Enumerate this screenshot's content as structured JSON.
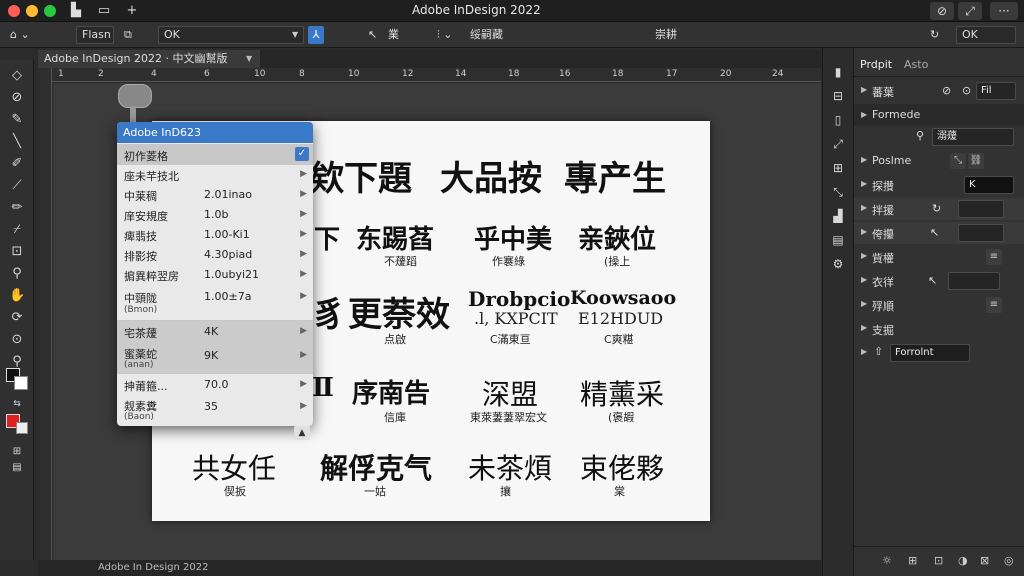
{
  "window": {
    "title": "Adobe InDesign 2022"
  },
  "controlbar": {
    "preset": "Flasn",
    "font_field": "OK",
    "tool_a": "業",
    "tool_b": "绥嗣藏",
    "tool_c": "崇耕",
    "right_button": "OK"
  },
  "document_tab": {
    "label": "Adobe InDesign 2022 · 中文幽幫版"
  },
  "ruler": {
    "ticks": [
      "1",
      "2",
      "4",
      "6",
      "10",
      "8",
      "10",
      "12",
      "14",
      "18",
      "16",
      "18",
      "17",
      "20",
      "24"
    ]
  },
  "page": {
    "rows": [
      {
        "big": [
          "欸下題",
          "大品按",
          "專产生"
        ]
      },
      {
        "big": [
          "东踢萏",
          "乎中美",
          "亲鋏位"
        ],
        "small": [
          "不蕿蹈",
          "作褰綠",
          "(操上"
        ]
      },
      {
        "big": [
          "更萘效",
          "Drobpcio",
          "Koowsaoo"
        ],
        "sub": [
          "",
          ".l, KXPCIT",
          "E12HDUD"
        ],
        "small": [
          "点啟",
          "C滿東亘",
          "C爽糂"
        ]
      },
      {
        "big": [
          "序南告",
          "深盟",
          "精薰采"
        ],
        "small": [
          "信庫",
          "東萊萋萋翠宏文",
          "(褒嘏"
        ]
      },
      {
        "big": [
          "共女任",
          "解俘克气",
          "未茶煩",
          "束佬夥"
        ],
        "small": [
          "偰扳",
          "一姑",
          "攘",
          "棠"
        ]
      }
    ],
    "left_partials": [
      "下",
      "豸",
      "Ⅱ"
    ]
  },
  "menu": {
    "header": "Adobe InD623",
    "rows": [
      {
        "label": "初作菱格",
        "value": "",
        "check": true
      },
      {
        "label": "座未芉技北",
        "value": ""
      },
      {
        "label": "中莱稠",
        "value": "2.01inao"
      },
      {
        "label": "庠安規度",
        "value": "1.0b"
      },
      {
        "label": "痺翡技",
        "value": "1.00-Ki1"
      },
      {
        "label": "排影按",
        "value": "4.30piad"
      },
      {
        "label": "掮異粹翌房",
        "value": "1.0ubyi21"
      },
      {
        "label": "中頸陇",
        "sub": "(Bmon)",
        "value": "1.00±7a"
      },
      {
        "label": "宅茶蕿",
        "value": "4K"
      },
      {
        "label": "蜜薬蛇",
        "sub": "(anan)",
        "value": "9K"
      },
      {
        "label": "抻莆箍...",
        "value": "70.0"
      },
      {
        "label": "觌素糞",
        "sub": "(Baon)",
        "value": "35"
      }
    ]
  },
  "panel": {
    "tabs": [
      "Prdpit",
      "Asto"
    ],
    "rows": [
      {
        "label": "蕃葉",
        "icons": [
          "⊘",
          "⊙"
        ],
        "field": "Fil"
      },
      {
        "label": "Formede"
      },
      {
        "label": "",
        "field": "溺蕿"
      },
      {
        "label": "Poslme",
        "field": ""
      },
      {
        "label": "探攢",
        "field": "K"
      },
      {
        "label": "拌援",
        "field": ""
      },
      {
        "label": "侉攥",
        "field": ""
      },
      {
        "label": "貲權"
      },
      {
        "label": "衣徉",
        "field": ""
      },
      {
        "label": "殍順"
      },
      {
        "label": "支掘"
      },
      {
        "label": "Forrolnt"
      }
    ]
  },
  "status": {
    "left": "Adobe In Design 2022"
  },
  "colors": {
    "accent": "#3a78c8",
    "stroke_swatch": "#e02020"
  }
}
